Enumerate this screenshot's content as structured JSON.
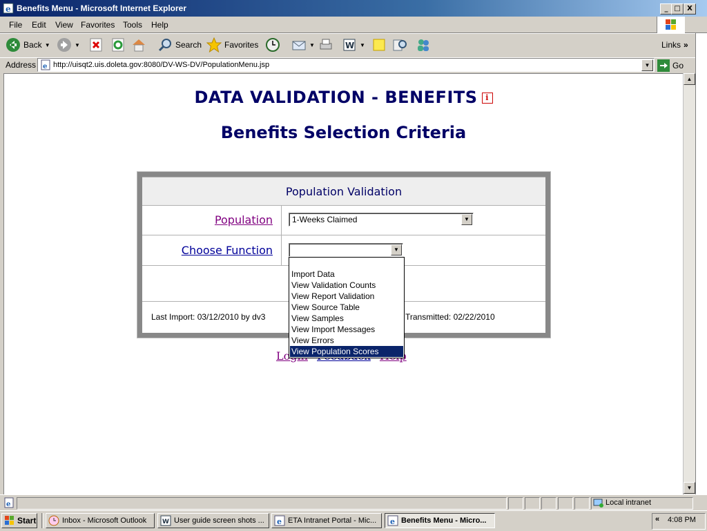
{
  "window": {
    "title": "Benefits Menu - Microsoft Internet Explorer",
    "minimize": "_",
    "maximize": "□",
    "close": "X"
  },
  "menu": [
    "File",
    "Edit",
    "View",
    "Favorites",
    "Tools",
    "Help"
  ],
  "toolbar": {
    "back_label": "Back",
    "search_label": "Search",
    "favorites_label": "Favorites",
    "links_label": "Links"
  },
  "address": {
    "label": "Address",
    "url": "http://uisqt2.uis.doleta.gov:8080/DV-WS-DV/PopulationMenu.jsp",
    "go_label": "Go"
  },
  "page": {
    "title": "DATA VALIDATION - BENEFITS",
    "info_icon": "i",
    "subtitle": "Benefits Selection Criteria",
    "panel_header": "Population Validation",
    "population_label": "Population",
    "population_value": "1-Weeks Claimed",
    "function_label": "Choose Function",
    "function_value": "",
    "last_import": "Last Import: 03/12/2010 by dv3",
    "transmitted": "Transmitted: 02/22/2010",
    "links": [
      "Login",
      "Feedback",
      "Help"
    ],
    "function_options": [
      "",
      "Import Data",
      "View Validation Counts",
      "View Report Validation",
      "View Source Table",
      "View Samples",
      "View Import Messages",
      "View Errors",
      "View Population Scores"
    ],
    "highlighted_option": "View Population Scores"
  },
  "status": {
    "zone": "Local intranet"
  },
  "taskbar": {
    "start": "Start",
    "tasks": [
      "Inbox - Microsoft Outlook",
      "User guide screen shots ...",
      "ETA Intranet Portal - Mic...",
      "Benefits Menu - Micro..."
    ],
    "active_task": "Benefits Menu - Micro...",
    "tray_chevron": "«",
    "clock": "4:08 PM"
  },
  "colors": {
    "heading": "#000066",
    "link": "#000099",
    "visited_link": "#800080",
    "highlight": "#0a246a"
  }
}
